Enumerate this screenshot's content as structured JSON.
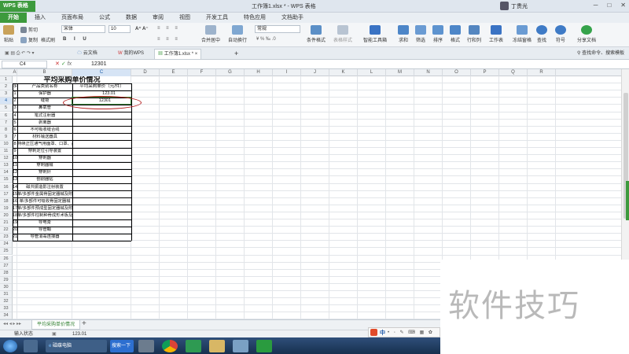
{
  "title_bar": {
    "app_button": "WPS 表格",
    "document_title": "工作簿1.xlsx * - WPS 表格",
    "user_name": "丁贵光"
  },
  "menu_tabs": [
    "开始",
    "插入",
    "页面布局",
    "公式",
    "数据",
    "审阅",
    "视图",
    "开发工具",
    "特色应用",
    "文档助手"
  ],
  "ribbon": {
    "cut": "剪切",
    "paste": "粘贴",
    "copy": "复制",
    "format_painter": "格式刷",
    "font_name": "宋体",
    "font_size": "10",
    "merge_center": "合并居中",
    "wrap_text": "自动换行",
    "number_format": "常规",
    "conditional_format": "条件格式",
    "table_style": "表格样式",
    "smart_toolbox": "智能工具箱",
    "sum": "求和",
    "filter": "筛选",
    "sort": "排序",
    "format": "格式",
    "row_col": "行和列",
    "worksheet": "工作表",
    "freeze": "冻结窗格",
    "find": "查找",
    "symbol": "符号",
    "share": "分享文档"
  },
  "doc_tabs": {
    "cloud": "云文档",
    "mywps": "我的WPS",
    "workbook": "工作簿1.xlsx *",
    "search": "查找命令、搜索模板"
  },
  "formula_bar": {
    "cell_ref": "C4",
    "value": "12301"
  },
  "columns": [
    "A",
    "B",
    "C",
    "D",
    "E",
    "F",
    "G",
    "H",
    "I",
    "J",
    "K",
    "L",
    "M",
    "N",
    "O",
    "P",
    "Q",
    "R"
  ],
  "sheet": {
    "title": "平均采购单价情况",
    "headers": [
      "序号",
      "产品类别名称",
      "平均采购单价（元/件）"
    ],
    "rows": [
      {
        "no": "1",
        "name": "保护器",
        "price": "123.01"
      },
      {
        "no": "2",
        "name": "缝荷",
        "price": "12301"
      },
      {
        "no": "3",
        "name": "鼻氧管",
        "price": ""
      },
      {
        "no": "4",
        "name": "笔式注射器",
        "price": ""
      },
      {
        "no": "5",
        "name": "剥离器",
        "price": ""
      },
      {
        "no": "6",
        "name": "不可吸收缝合线",
        "price": ""
      },
      {
        "no": "7",
        "name": "材料输送器具",
        "price": ""
      },
      {
        "no": "8",
        "name": "持续正压通气用面罩、口罩、鼻罩",
        "price": ""
      },
      {
        "no": "9",
        "name": "穿刺定位引导装置",
        "price": ""
      },
      {
        "no": "10",
        "name": "穿刺器",
        "price": ""
      },
      {
        "no": "11",
        "name": "穿刺器械",
        "price": ""
      },
      {
        "no": "12",
        "name": "穿刺针",
        "price": ""
      },
      {
        "no": "13",
        "name": "刨削器钻",
        "price": ""
      },
      {
        "no": "14",
        "name": "磁共振造影注射装置",
        "price": ""
      },
      {
        "no": "15",
        "name": "单/多部件金属骨固定器械及附件",
        "price": ""
      },
      {
        "no": "16",
        "name": "单/多部件可吸收骨固定器械",
        "price": ""
      },
      {
        "no": "17",
        "name": "单/多部件预成型固定器械及附件",
        "price": ""
      },
      {
        "no": "18",
        "name": "单/多部件柱制种骨成形术板及紧固件",
        "price": ""
      },
      {
        "no": "19",
        "name": "导电膏",
        "price": ""
      },
      {
        "no": "20",
        "name": "导管鞘",
        "price": ""
      },
      {
        "no": "21",
        "name": "导管消毒连接器",
        "price": ""
      }
    ]
  },
  "sheet_tab": "平均采购单价情况",
  "status": {
    "mode": "输入状态",
    "value": "123.01"
  },
  "taskbar": {
    "computer": "磁碟电脑",
    "search": "搜索一下"
  },
  "ime": "中",
  "watermark": "软件技巧",
  "colors": {
    "accent": "#3d9a3d",
    "annotation": "#b31b1b"
  }
}
